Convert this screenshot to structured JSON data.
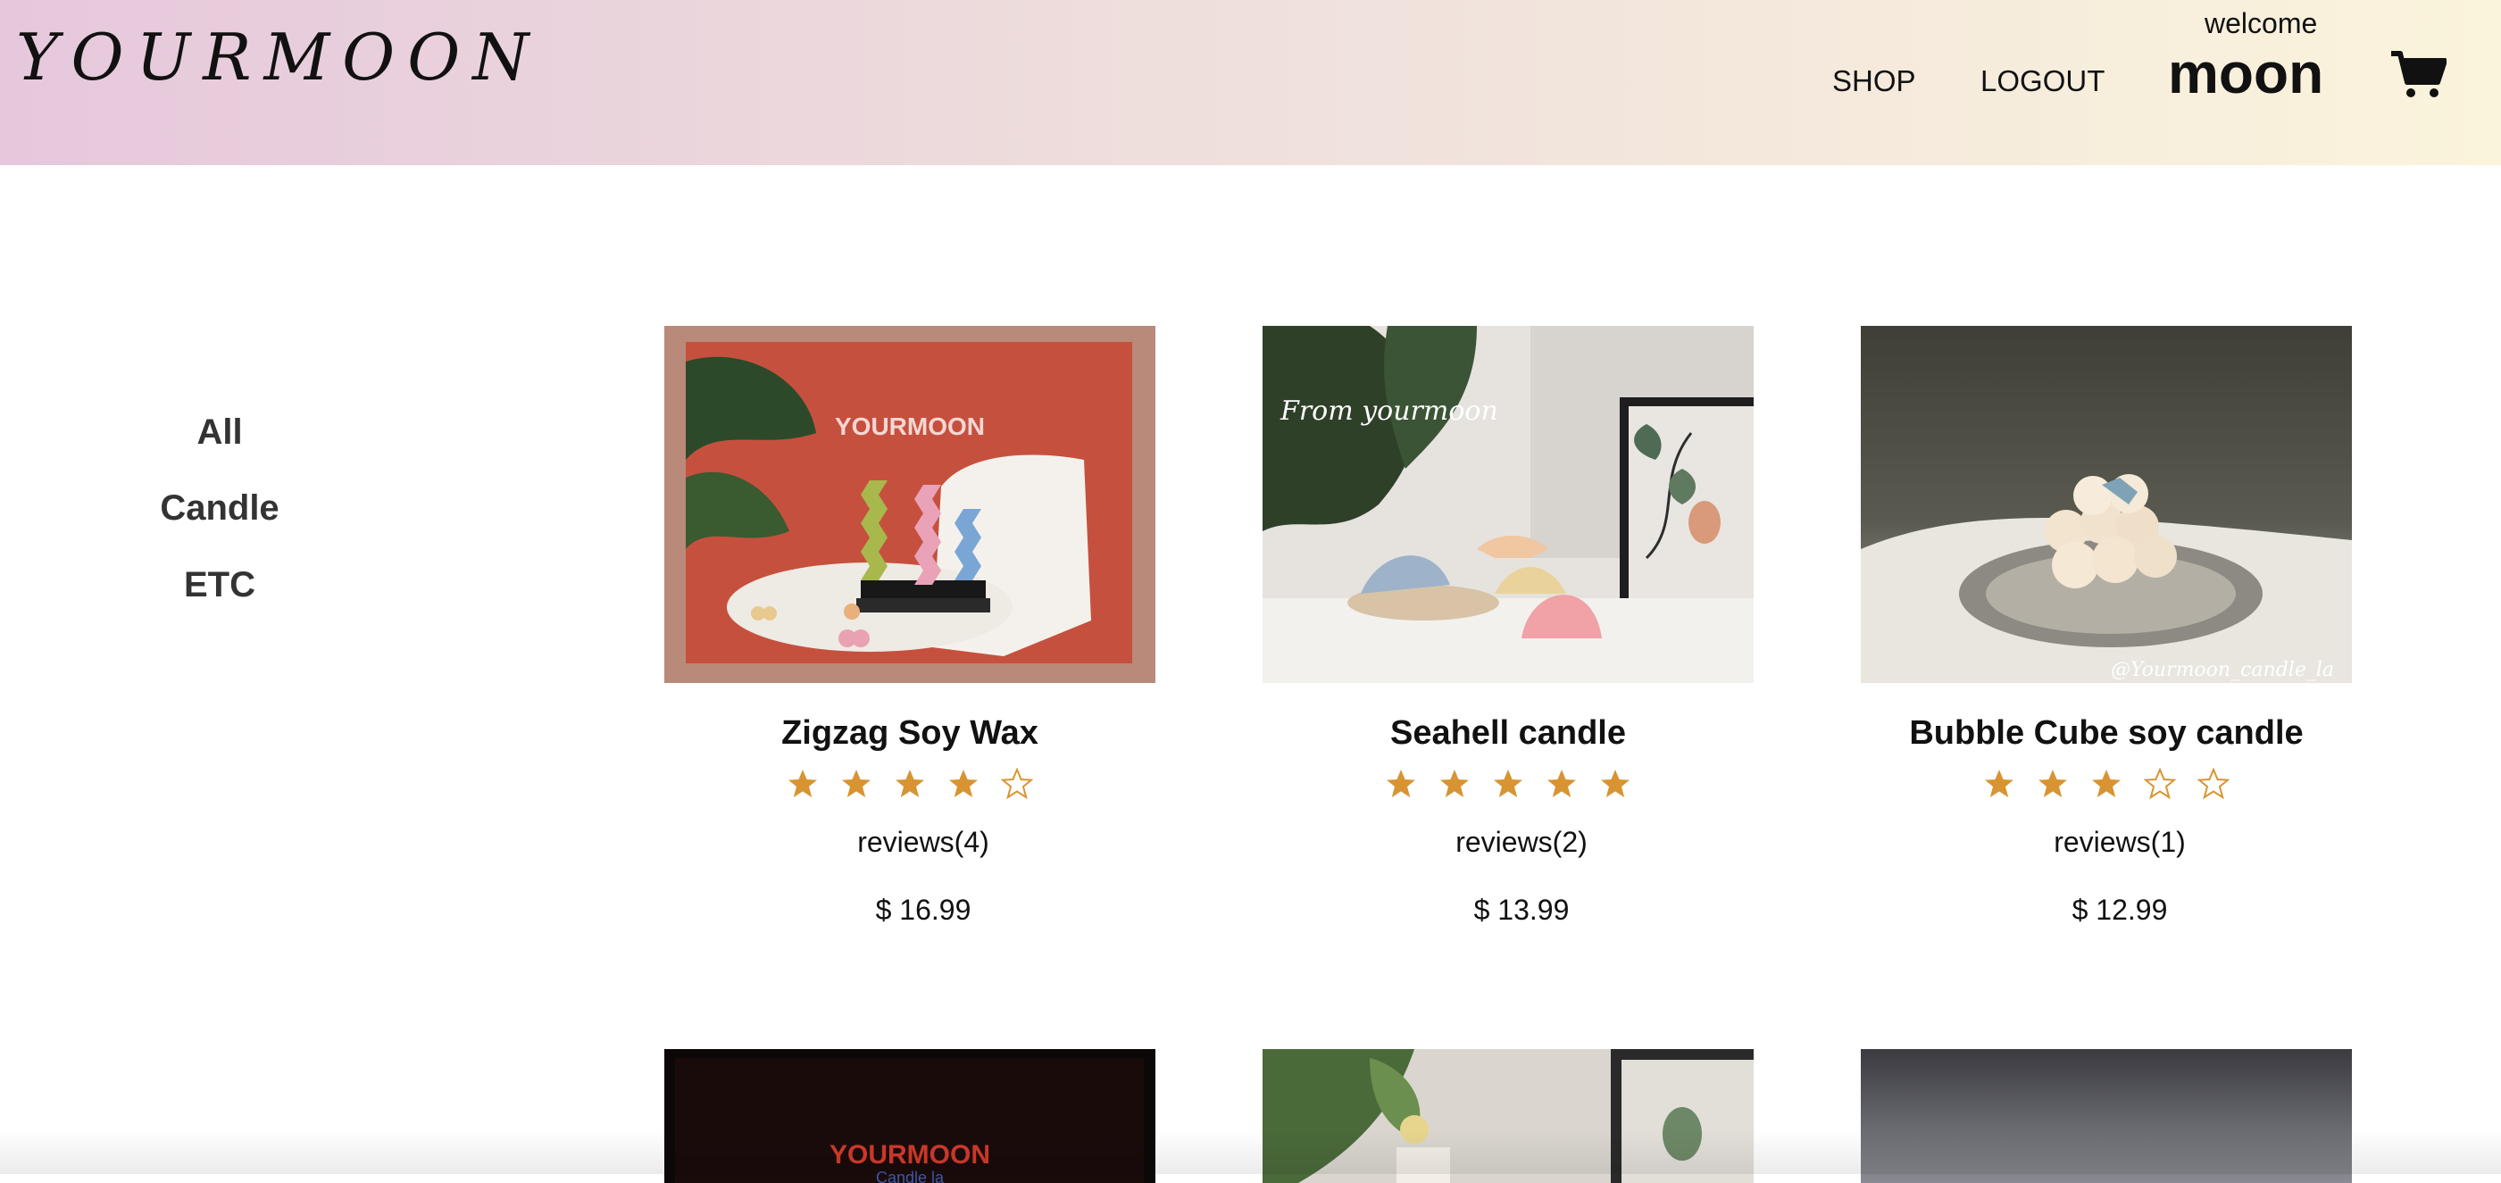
{
  "header": {
    "logo": "YOURMOON",
    "nav": {
      "shop": "SHOP",
      "logout": "LOGOUT"
    },
    "welcome": "welcome",
    "username": "moon",
    "cart_icon": "shopping-cart-icon"
  },
  "sidebar": {
    "categories": [
      "All",
      "Candle",
      "ETC"
    ]
  },
  "products": [
    {
      "name": "Zigzag Soy Wax",
      "rating": 4,
      "max_rating": 5,
      "reviews": "reviews(4)",
      "price": "$ 16.99",
      "image_text": "YOURMOON"
    },
    {
      "name": "Seahell candle",
      "rating": 5,
      "max_rating": 5,
      "reviews": "reviews(2)",
      "price": "$ 13.99",
      "image_text": "From yourmoon"
    },
    {
      "name": "Bubble Cube soy candle",
      "rating": 3,
      "max_rating": 5,
      "reviews": "reviews(1)",
      "price": "$ 12.99",
      "image_text": "@Yourmoon_candle_la"
    }
  ],
  "products_row2": [
    {
      "image_text": "YOURMOON",
      "image_subtext": "Candle la"
    },
    {
      "image_text": ""
    },
    {
      "image_text": ""
    }
  ],
  "colors": {
    "star": "#d89432",
    "header_left": "#e6c8dc",
    "header_right": "#fbf4dc"
  }
}
